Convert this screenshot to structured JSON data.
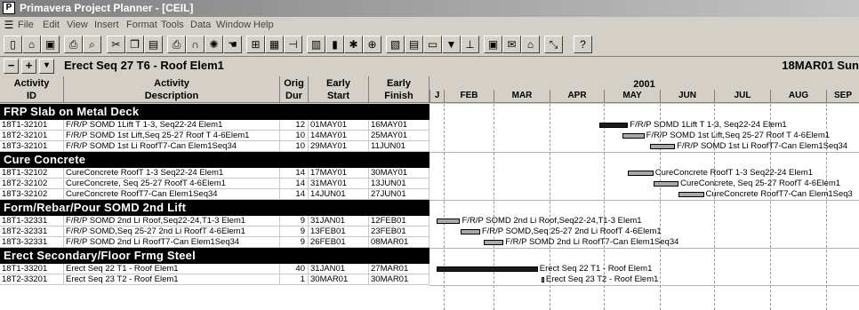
{
  "window": {
    "title": "Primavera Project Planner - [CEIL]"
  },
  "menu": [
    "File",
    "Edit",
    "View",
    "Insert",
    "Format",
    "Tools",
    "Data",
    "Window",
    "Help"
  ],
  "toolbar": {
    "icons": [
      "new-icon",
      "open-icon",
      "save-icon",
      "print-icon",
      "print-preview-icon",
      "cut-icon",
      "copy-icon",
      "paste-icon",
      "printer-icon",
      "find-icon",
      "web-icon",
      "hand-icon",
      "layout-icon",
      "table-icon",
      "logic-icon",
      "bar-chart-icon",
      "column-icon",
      "star-icon",
      "network-icon",
      "format-icon",
      "grid-icon",
      "schedule-icon",
      "filter-icon",
      "organize-icon",
      "screen-icon",
      "mail-icon",
      "attach-icon",
      "zoom-icon",
      "help-icon"
    ]
  },
  "editbar": {
    "minus": "−",
    "plus": "+",
    "dropdown": "▾",
    "text": "Erect Seq 27 T6 - Roof Elem1",
    "date": "18MAR01 Sun"
  },
  "columns": {
    "id": [
      "Activity",
      "ID"
    ],
    "desc": [
      "Activity",
      "Description"
    ],
    "dur": [
      "Orig",
      "Dur"
    ],
    "start": [
      "Early",
      "Start"
    ],
    "finish": [
      "Early",
      "Finish"
    ]
  },
  "timescale": {
    "year": "2001",
    "months": [
      "J",
      "FEB",
      "MAR",
      "APR",
      "MAY",
      "JUN",
      "JUL",
      "AUG",
      "SEP"
    ]
  },
  "groups": [
    {
      "title": "FRP Slab on Metal Deck",
      "rows": [
        {
          "id": "18T1-32101",
          "desc": "F/R/P SOMD 1Lift T 1-3, Seq22-24 Elem1",
          "dur": "12",
          "start": "01MAY01",
          "finish": "16MAY01",
          "bar_label": "F/R/P SOMD 1Lift T 1-3, Seq22-24 Elem1"
        },
        {
          "id": "18T2-32101",
          "desc": "F/R/P SOMD 1st Lift,Seq 25-27 Roof T 4-6Elem1",
          "dur": "10",
          "start": "14MAY01",
          "finish": "25MAY01",
          "bar_label": "F/R/P SOMD 1st Lift,Seq 25-27 Roof T 4-6Elem1"
        },
        {
          "id": "18T3-32101",
          "desc": "F/R/P SOMD 1st Li RoofT7-Can Elem1Seq34",
          "dur": "10",
          "start": "29MAY01",
          "finish": "11JUN01",
          "bar_label": "F/R/P SOMD 1st Li RoofT7-Can Elem1Seq34"
        }
      ]
    },
    {
      "title": "Cure Concrete",
      "rows": [
        {
          "id": "18T1-32102",
          "desc": "CureConcrete RoofT 1-3 Seq22-24 Elem1",
          "dur": "14",
          "start": "17MAY01",
          "finish": "30MAY01",
          "bar_label": "CureConcrete RoofT 1-3 Seq22-24 Elem1"
        },
        {
          "id": "18T2-32102",
          "desc": "CureConcrete, Seq 25-27 RoofT 4-6Elem1",
          "dur": "14",
          "start": "31MAY01",
          "finish": "13JUN01",
          "bar_label": "CureConcrete, Seq 25-27 RoofT 4-6Elem1"
        },
        {
          "id": "18T3-32102",
          "desc": "CureConcrete RoofT7-Can Elem1Seq34",
          "dur": "14",
          "start": "14JUN01",
          "finish": "27JUN01",
          "bar_label": "CureConcrete RoofT7-Can Elem1Seq3"
        }
      ]
    },
    {
      "title": "Form/Rebar/Pour SOMD 2nd Lift",
      "rows": [
        {
          "id": "18T1-32331",
          "desc": "F/R/P SOMD 2nd Li Roof,Seq22-24,T1-3 Elem1",
          "dur": "9",
          "start": "31JAN01",
          "finish": "12FEB01",
          "bar_label": "F/R/P SOMD 2nd Li Roof,Seq22-24,T1-3 Elem1"
        },
        {
          "id": "18T2-32331",
          "desc": "F/R/P SOMD,Seq 25-27 2nd Li RoofT 4-6Elem1",
          "dur": "9",
          "start": "13FEB01",
          "finish": "23FEB01",
          "bar_label": "F/R/P SOMD,Seq 25-27 2nd Li RoofT 4-6Elem1"
        },
        {
          "id": "18T3-32331",
          "desc": "F/R/P SOMD 2nd Li RoofT7-Can Elem1Seq34",
          "dur": "9",
          "start": "26FEB01",
          "finish": "08MAR01",
          "bar_label": "F/R/P SOMD 2nd Li RoofT7-Can Elem1Seq34"
        }
      ]
    },
    {
      "title": "Erect Secondary/Floor Frmg Steel",
      "rows": [
        {
          "id": "18T1-33201",
          "desc": "Erect Seq 22 T1 - Roof Elem1",
          "dur": "40",
          "start": "31JAN01",
          "finish": "27MAR01",
          "bar_label": "Erect Seq 22 T1 - Roof Elem1"
        },
        {
          "id": "18T2-33201",
          "desc": "Erect Seq 23 T2 - Roof Elem1",
          "dur": "1",
          "start": "30MAR01",
          "finish": "30MAR01",
          "bar_label": "Erect Seq 23 T2 - Roof Elem1"
        }
      ]
    }
  ],
  "colors": {
    "critical_bar": "#1a1a1a",
    "normal_bar": "#a8a8a8",
    "group_band": "#000000"
  }
}
